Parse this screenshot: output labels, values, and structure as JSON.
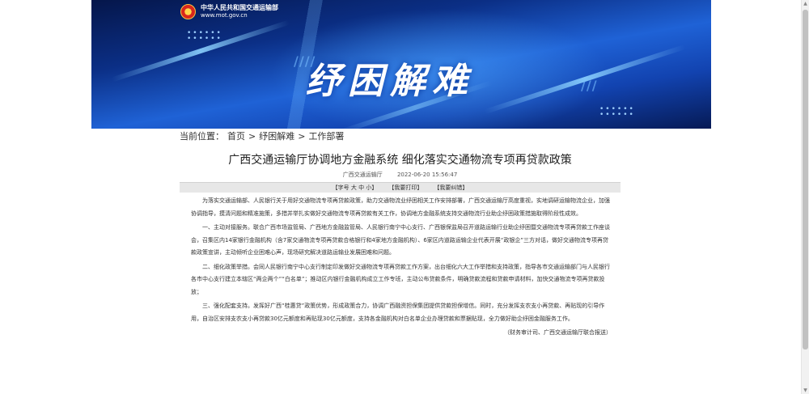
{
  "header": {
    "site_name": "中华人民共和国交通运输部",
    "site_url": "www.mot.gov.cn",
    "banner_title": "纾困解难",
    "emblem_icon": "national-emblem-icon",
    "banner_color": "#1a4fc4"
  },
  "breadcrumb": {
    "prefix": "当前位置：",
    "items": [
      "首页",
      "纾困解难",
      "工作部署"
    ],
    "separator": ">"
  },
  "article": {
    "title": "广西交通运输厅协调地方金融系统 细化落实交通物流专项再贷款政策",
    "source": "广西交通运输厅",
    "datetime": "2022-06-20 15:56:47",
    "toolbar": {
      "font_size": "【字号 大 中 小】",
      "print": "【我要打印】",
      "correct": "【我要纠错】"
    },
    "paragraphs": [
      "为落实交通运输部、人民银行关于用好交通物流专项再贷款政策，助力交通物流业纾困相关工作安排部署，广西交通运输厅高度重视，实地调研运输物流企业，加强协调指导，摸清问题和精准施策，多措并举扎实做好交通物流专项再贷款有关工作，协调地方金融系统支持交通物流行业助企纾困政策措施取得阶段性成效。",
      "一、主动对接服务。联合广西市场监管局、广西地方金融监管局、人民银行南宁中心支行、广西银保监局召开道路运输行业助企纾困暨交通物流专项再贷款工作座谈会，召集区内14家银行金融机构（含7家交通物流专项再贷款合格银行和4家地方金融机构）、6家区内道路运输企业代表开展“政银企”三方对话，做好交通物流专项再贷款政策宣讲，主动倾听企业困难心声，现场研究解决道路运输业发展困难和问题。",
      "二、细化政策举措。会同人民银行南宁中心支行制定印发做好交通物流专项再贷款工作方案，出台细化六大工作举措和支持政策，指导各市交通运输部门与人民银行各市中心支行建立本辖区“两企两个”“白名单”；推动区内银行金融机构成立工作专班，主动公布贷款条件，明确贷款流程和贷款申请材料，加快交通物流专项再贷款投放；",
      "三、强化配套支持。发挥好广西“桂惠贷”政策优势，形成政策合力，协调广西融资担保集团提供贷款担保增信。同时，充分发挥支农支小再贷款、再贴现的引导作用，自治区安排支农支小再贷款30亿元额度和再贴现30亿元额度，支持各金融机构对白名单企业办理贷款和票据贴现，全力做好助企纾困金融服务工作。"
    ],
    "footer_source": "（财务审计司、广西交通运输厅联合报送）"
  }
}
